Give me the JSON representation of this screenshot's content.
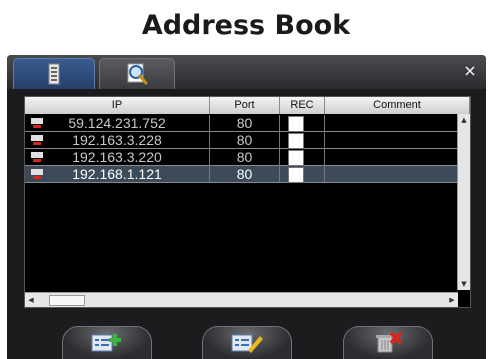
{
  "title": "Address Book",
  "tabs": [
    {
      "icon": "address-book-icon",
      "active": true
    },
    {
      "icon": "search-icon",
      "active": false
    }
  ],
  "close_label": "×",
  "table": {
    "columns": [
      "IP",
      "Port",
      "REC",
      "Comment"
    ],
    "rows": [
      {
        "ip": "59.124.231.752",
        "port": "80",
        "rec": false,
        "comment": "",
        "selected": false
      },
      {
        "ip": "192.163.3.228",
        "port": "80",
        "rec": false,
        "comment": "",
        "selected": false
      },
      {
        "ip": "192.163.3.220",
        "port": "80",
        "rec": false,
        "comment": "",
        "selected": false
      },
      {
        "ip": "192.168.1.121",
        "port": "80",
        "rec": false,
        "comment": "",
        "selected": true
      }
    ]
  },
  "buttons": [
    {
      "icon": "add-entry-icon"
    },
    {
      "icon": "edit-entry-icon"
    },
    {
      "icon": "delete-entry-icon"
    }
  ],
  "colors": {
    "accent": "#3a5b8e",
    "dialog_bg": "#1b1c1e",
    "delete_red": "#d9261c"
  }
}
